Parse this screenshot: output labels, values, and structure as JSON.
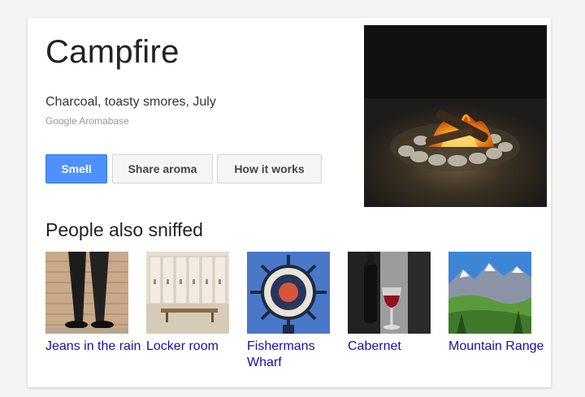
{
  "entity": {
    "title": "Campfire",
    "subtitle": "Charcoal, toasty smores, July",
    "source": "Google Aromabase"
  },
  "actions": {
    "smell": "Smell",
    "share": "Share aroma",
    "how": "How it works"
  },
  "related": {
    "heading": "People also sniffed",
    "items": [
      {
        "label": "Jeans in the rain"
      },
      {
        "label": "Locker room"
      },
      {
        "label": "Fishermans Wharf"
      },
      {
        "label": "Cabernet"
      },
      {
        "label": "Mountain Range"
      }
    ]
  },
  "colors": {
    "link": "#1a0dab",
    "primary_button": "#4d90fe"
  }
}
